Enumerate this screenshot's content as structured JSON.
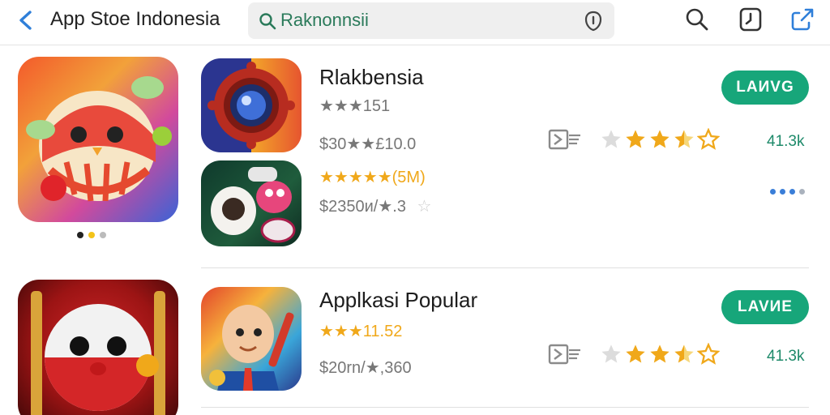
{
  "header": {
    "title": "App Stoe Indonesia",
    "search_value": "Raknonnsii",
    "back_icon": "chevron-left-icon",
    "search_icon": "search-icon",
    "mic_icon": "info-shield-icon",
    "action_icons": [
      "search-icon",
      "clock-icon",
      "share-icon"
    ]
  },
  "carousel": {
    "dot_colors": [
      "#222222",
      "#f3c31a",
      "#bbbbbb"
    ]
  },
  "apps": [
    {
      "name": "Rlakbensia",
      "rating_text": "★★★151",
      "price_text": "$30★★£10.0",
      "action_label": "LAИVG",
      "count": "41.3k",
      "stars": 3.5
    },
    {
      "rating_text": "★★★★★(5M)",
      "price_text": "$2350и/★.3",
      "extra_star": "☆"
    }
  ],
  "section2": {
    "name": "Applkasi Popular",
    "rating_text": "★★★11.52",
    "price_text": "$20rn/★,360",
    "action_label": "LAVИE",
    "count": "41.3k",
    "stars": 3.5
  },
  "colors": {
    "accent_green": "#17a67a",
    "star_orange": "#f0a81a",
    "link_blue": "#2f7fd9"
  }
}
